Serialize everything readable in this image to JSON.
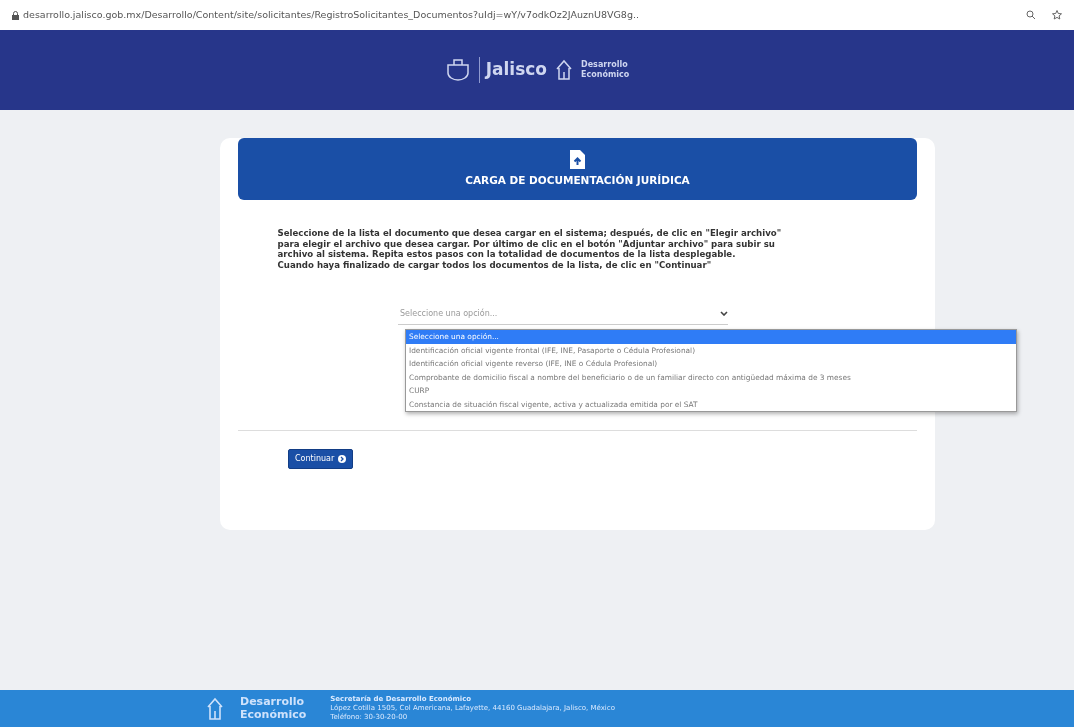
{
  "browser": {
    "url": "desarrollo.jalisco.gob.mx/Desarrollo/Content/site/solicitantes/RegistroSolicitantes_Documentos?uIdj=wY/v7odkOz2JAuznU8VG8g.."
  },
  "header": {
    "logo_text": "Jalisco",
    "secondary_logo": [
      "Desarrollo",
      "Económico"
    ]
  },
  "card": {
    "title": "CARGA DE DOCUMENTACIÓN JURÍDICA",
    "instructions": [
      "Seleccione de la lista el documento que desea cargar en el sistema; después, de clic en \"Elegir archivo\"",
      "para elegir el archivo que desea cargar. Por último de clic en el botón \"Adjuntar archivo\" para subir su",
      "archivo al sistema. Repita estos pasos con la totalidad de documentos de la lista desplegable.",
      "Cuando haya finalizado de cargar todos los documentos de la lista, de clic en \"Continuar\""
    ],
    "select": {
      "value": "Seleccione una opción...",
      "expanded": true,
      "options": [
        {
          "label": "Seleccione una opción...",
          "selected": true
        },
        {
          "label": "Identificación oficial vigente frontal (IFE, INE, Pasaporte o Cédula Profesional)",
          "selected": false
        },
        {
          "label": "Identificación oficial vigente reverso (IFE, INE o Cédula Profesional)",
          "selected": false
        },
        {
          "label": "Comprobante de domicilio fiscal a nombre del beneficiario o de un familiar directo con antigüedad máxima de 3 meses",
          "selected": false
        },
        {
          "label": "CURP",
          "selected": false
        },
        {
          "label": "Constancia de situación fiscal vigente, activa y actualizada emitida por el SAT",
          "selected": false
        }
      ]
    },
    "button": "Continuar"
  },
  "footer": {
    "logo": [
      "Desarrollo",
      "Económico"
    ],
    "lines": [
      "Secretaría de Desarrollo Económico",
      "López Cotilla 1505, Col Americana, Lafayette, 44160 Guadalajara, Jalisco, México",
      "Teléfono: 30-30-20-00"
    ]
  }
}
